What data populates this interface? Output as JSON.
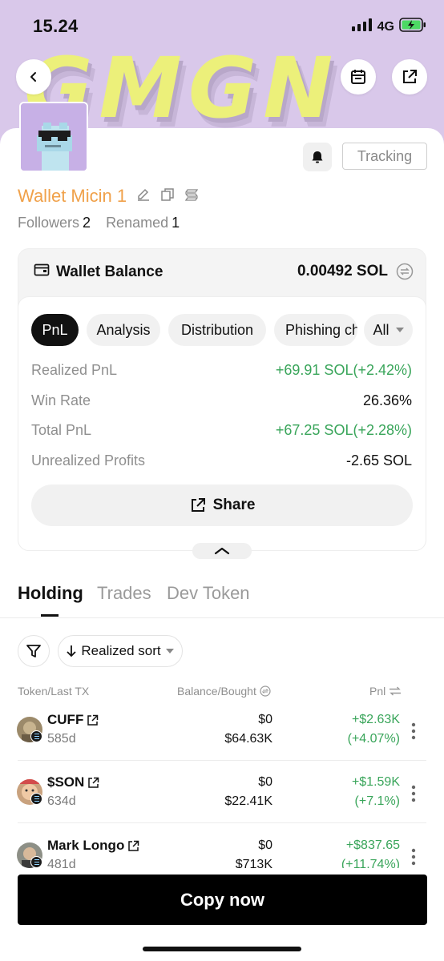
{
  "status_bar": {
    "time": "15.24",
    "network": "4G"
  },
  "banner": {
    "logo_text": "GMGN"
  },
  "profile": {
    "wallet_name": "Wallet Micin 1",
    "followers_label": "Followers",
    "followers_count": "2",
    "renamed_label": "Renamed",
    "renamed_count": "1",
    "tracking_label": "Tracking"
  },
  "balance": {
    "title": "Wallet Balance",
    "value": "0.00492 SOL"
  },
  "filter_chips": [
    "PnL",
    "Analysis",
    "Distribution",
    "Phishing ch"
  ],
  "period_select": "All",
  "stats": [
    {
      "label": "Realized PnL",
      "value": "+69.91 SOL(+2.42%)"
    },
    {
      "label": "Win Rate",
      "value": "26.36%"
    },
    {
      "label": "Total PnL",
      "value": "+67.25 SOL(+2.28%)"
    },
    {
      "label": "Unrealized Profits",
      "value": "-2.65 SOL"
    }
  ],
  "share_label": "Share",
  "tabs": [
    "Holding",
    "Trades",
    "Dev Token"
  ],
  "sort_label": "Realized sort",
  "columns": {
    "token": "Token/Last TX",
    "balance": "Balance/Bought",
    "pnl": "Pnl"
  },
  "holdings": [
    {
      "name": "CUFF",
      "age": "585d",
      "balance": "$0",
      "bought": "$64.63K",
      "pnl": "+$2.63K",
      "pnl_pct": "(+4.07%)"
    },
    {
      "name": "$SON",
      "age": "634d",
      "balance": "$0",
      "bought": "$22.41K",
      "pnl": "+$1.59K",
      "pnl_pct": "(+7.1%)"
    },
    {
      "name": "Mark Longo",
      "age": "481d",
      "balance": "$0",
      "bought": "$713K",
      "pnl": "+$837.65",
      "pnl_pct": "(+11.74%)"
    }
  ],
  "copy_label": "Copy now",
  "colors": {
    "accent_orange": "#f0a14a",
    "positive_green": "#39a55a",
    "banner_purple": "#d9c8ea",
    "logo_yellow": "#ecf07a"
  }
}
